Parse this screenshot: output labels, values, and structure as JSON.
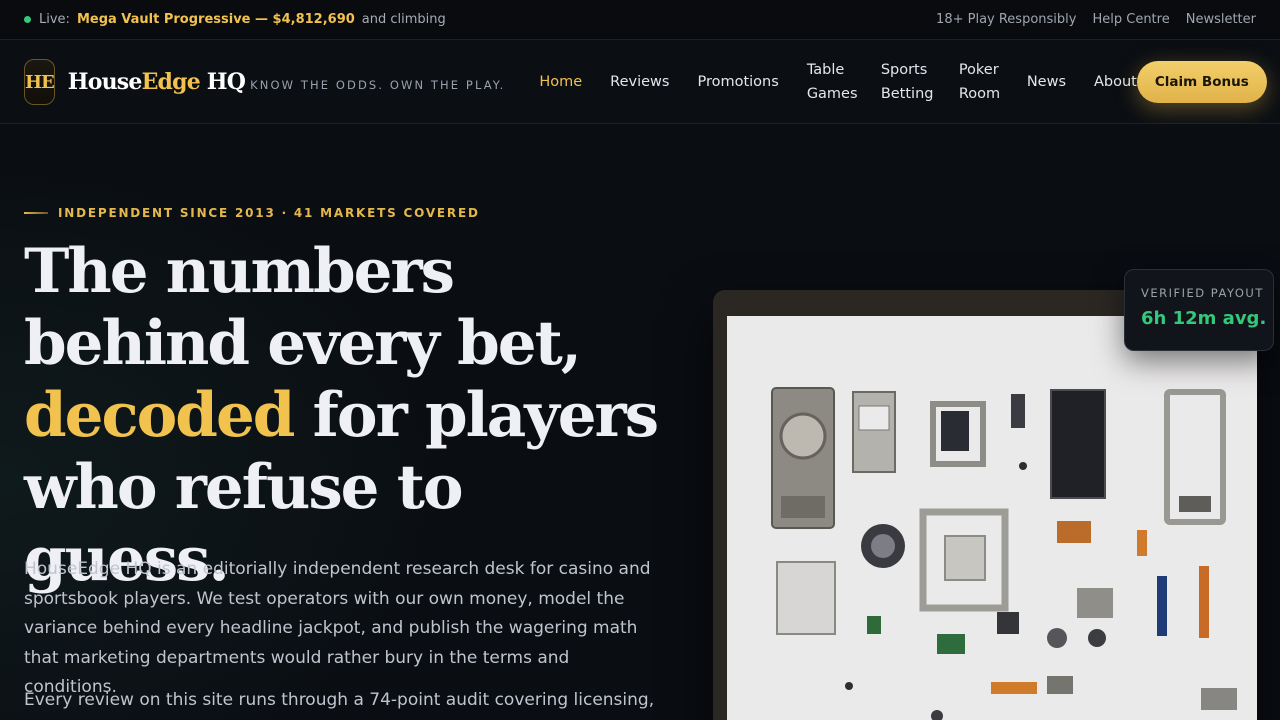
{
  "topbar": {
    "live_label": "Live:",
    "jackpot": "Mega Vault Progressive — $4,812,690",
    "jackpot_suffix": "and climbing",
    "links": [
      "18+ Play Responsibly",
      "Help Centre",
      "Newsletter"
    ]
  },
  "header": {
    "logo_mark": "HE",
    "brand_part1": "House",
    "brand_part2": "Edge",
    "brand_part3": " HQ",
    "tagline": "KNOW THE ODDS. OWN THE PLAY.",
    "nav": [
      {
        "label": "Home",
        "active": true
      },
      {
        "label": "Reviews"
      },
      {
        "label": "Promotions"
      },
      {
        "label": "Table Games"
      },
      {
        "label": "Sports Betting"
      },
      {
        "label": "Poker Room"
      },
      {
        "label": "News"
      },
      {
        "label": "About"
      }
    ],
    "cta": "Claim Bonus"
  },
  "hero": {
    "eyebrow": "INDEPENDENT SINCE 2013 · 41 MARKETS COVERED",
    "headline_before": "The numbers behind every bet, ",
    "headline_highlight": "decoded",
    "headline_after": " for players who refuse to guess.",
    "lede": "HouseEdge HQ is an editorially independent research desk for casino and sportsbook players. We test operators with our own money, model the variance behind every headline jackpot, and publish the wagering math that marketing departments would rather bury in the terms and conditions.",
    "lede2": "Every review on this site runs through a 74-point audit covering licensing,",
    "payout_card": {
      "label": "VERIFIED PAYOUT",
      "value": "6h 12m avg."
    }
  },
  "colors": {
    "accent": "#f1c24e",
    "background": "#0a0d12",
    "positive": "#35c77a"
  }
}
